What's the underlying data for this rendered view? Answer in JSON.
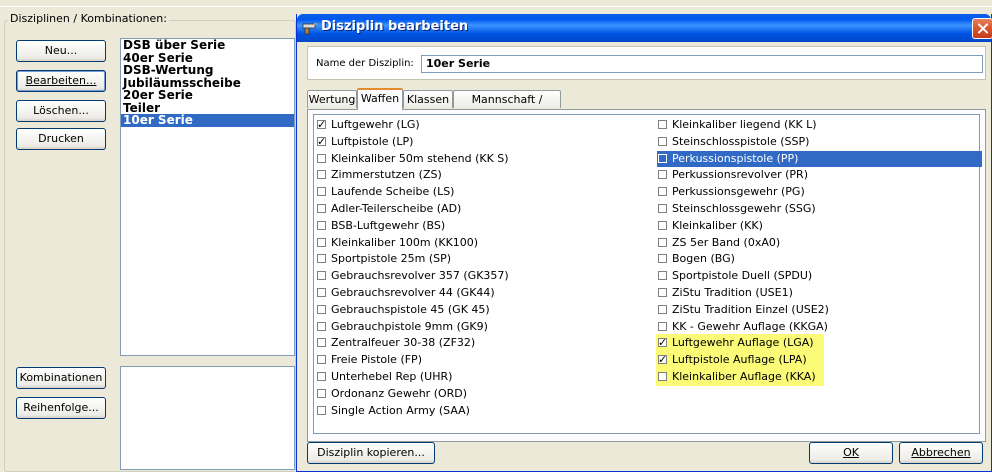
{
  "left_panel": {
    "group_title": "Disziplinen / Kombinationen:",
    "buttons": [
      "Neu...",
      "Bearbeiten...",
      "Löschen...",
      "Drucken"
    ],
    "disciplines": [
      "DSB über Serie",
      "40er Serie",
      "DSB-Wertung",
      "Jubiläumsscheibe",
      "20er Serie",
      "Teiler",
      "10er Serie"
    ],
    "selected_discipline": "10er Serie",
    "bottom_buttons": [
      "Kombinationen",
      "Reihenfolge..."
    ]
  },
  "dialog": {
    "title": "Disziplin bearbeiten",
    "name_label": "Name der Disziplin:",
    "name_value": "10er Serie",
    "tabs": [
      "Wertung",
      "Waffen",
      "Klassen",
      "Mannschaft / Verein"
    ],
    "active_tab": "Waffen",
    "weapons_left": [
      {
        "label": "Luftgewehr (LG)",
        "checked": true
      },
      {
        "label": "Luftpistole (LP)",
        "checked": true
      },
      {
        "label": "Kleinkaliber 50m stehend (KK S)",
        "checked": false
      },
      {
        "label": "Zimmerstutzen (ZS)",
        "checked": false
      },
      {
        "label": "Laufende Scheibe (LS)",
        "checked": false
      },
      {
        "label": "Adler-Teilerscheibe (AD)",
        "checked": false
      },
      {
        "label": "BSB-Luftgewehr (BS)",
        "checked": false
      },
      {
        "label": "Kleinkaliber 100m (KK100)",
        "checked": false
      },
      {
        "label": "Sportpistole 25m (SP)",
        "checked": false
      },
      {
        "label": "Gebrauchsrevolver 357 (GK357)",
        "checked": false
      },
      {
        "label": "Gebrauchsrevolver 44 (GK44)",
        "checked": false
      },
      {
        "label": "Gebrauchspistole 45 (GK 45)",
        "checked": false
      },
      {
        "label": "Gebrauchpistole 9mm (GK9)",
        "checked": false
      },
      {
        "label": "Zentralfeuer 30-38 (ZF32)",
        "checked": false
      },
      {
        "label": "Freie Pistole (FP)",
        "checked": false
      },
      {
        "label": "Unterhebel Rep (UHR)",
        "checked": false
      },
      {
        "label": "Ordonanz Gewehr (ORD)",
        "checked": false
      },
      {
        "label": "Single Action Army (SAA)",
        "checked": false
      }
    ],
    "weapons_right": [
      {
        "label": "Kleinkaliber liegend (KK L)",
        "checked": false
      },
      {
        "label": "Steinschlosspistole (SSP)",
        "checked": false
      },
      {
        "label": "Perkussionspistole (PP)",
        "checked": false,
        "selected": true
      },
      {
        "label": "Perkussionsrevolver (PR)",
        "checked": false
      },
      {
        "label": "Perkussionsgewehr (PG)",
        "checked": false
      },
      {
        "label": "Steinschlossgewehr (SSG)",
        "checked": false
      },
      {
        "label": "Kleinkaliber (KK)",
        "checked": false
      },
      {
        "label": "ZS 5er Band (0xA0)",
        "checked": false
      },
      {
        "label": "Bogen (BG)",
        "checked": false
      },
      {
        "label": "Sportpistole Duell (SPDU)",
        "checked": false
      },
      {
        "label": "ZiStu Tradition (USE1)",
        "checked": false
      },
      {
        "label": "ZiStu Tradition Einzel (USE2)",
        "checked": false
      },
      {
        "label": "KK - Gewehr Auflage (KKGA)",
        "checked": false
      },
      {
        "label": "Luftgewehr Auflage (LGA)",
        "checked": true,
        "highlighted": true
      },
      {
        "label": "Luftpistole Auflage (LPA)",
        "checked": true,
        "highlighted": true
      },
      {
        "label": "Kleinkaliber Auflage (KKA)",
        "checked": false,
        "highlighted": true
      }
    ],
    "footer": {
      "copy_button": "Disziplin kopieren...",
      "ok_button": "OK",
      "cancel_button": "Abbrechen"
    },
    "colors": {
      "selection": "#316ac5",
      "highlight": "#fbfb78",
      "titlebar": "#0054e3"
    }
  }
}
